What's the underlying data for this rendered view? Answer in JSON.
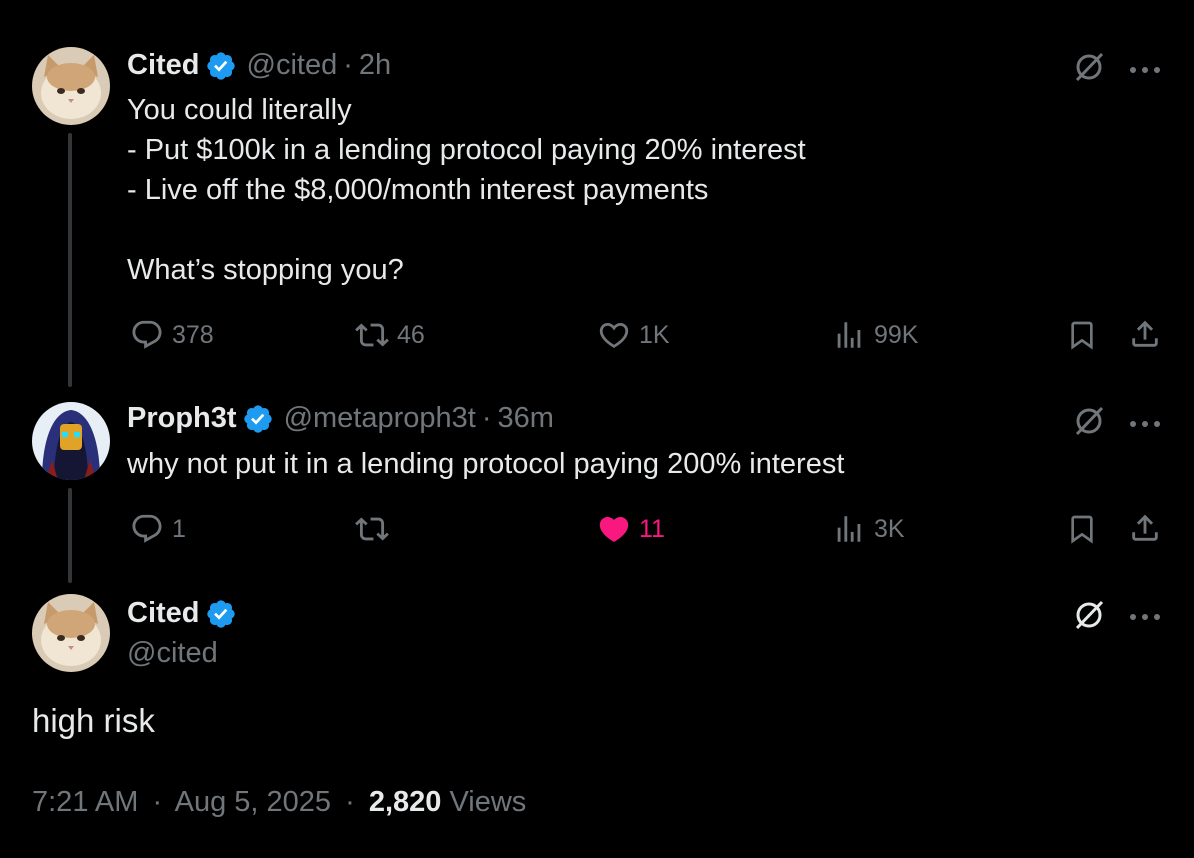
{
  "tweets": [
    {
      "name": "Cited",
      "handle": "@cited",
      "time": "2h",
      "lines": [
        "You could literally",
        "- Put $100k in a lending protocol paying 20% interest",
        "- Live off the $8,000/month interest payments",
        "",
        "What’s stopping you?"
      ],
      "replies": "378",
      "reposts": "46",
      "likes": "1K",
      "views": "99K"
    },
    {
      "name": "Proph3t",
      "handle": "@metaproph3t",
      "time": "36m",
      "lines": [
        "why not put it in a lending protocol paying 200% interest"
      ],
      "replies": "1",
      "reposts": "",
      "likes": "11",
      "views": "3K"
    }
  ],
  "main": {
    "name": "Cited",
    "handle": "@cited",
    "text": "high risk",
    "time": "7:21 AM",
    "date": "Aug 5, 2025",
    "views_count": "2,820",
    "views_label": "Views"
  },
  "colors": {
    "background": "#000000",
    "text": "#e7e9ea",
    "muted": "#71767b",
    "verified": "#1d9bf0",
    "like": "#f91880"
  },
  "icons": [
    "verified-badge-icon",
    "grok-icon",
    "more-icon",
    "reply-icon",
    "repost-icon",
    "like-icon",
    "views-icon",
    "bookmark-icon",
    "share-icon"
  ]
}
